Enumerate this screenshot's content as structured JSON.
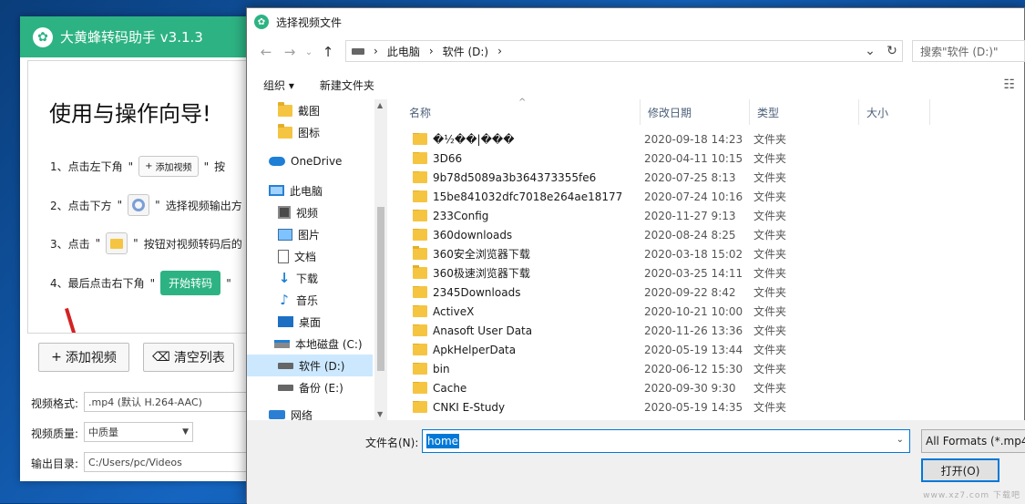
{
  "app": {
    "title": "大黄蜂转码助手 v3.1.3",
    "logo_text": "✿",
    "guide_title": "使用与操作向导!",
    "step1_prefix": "1、点击左下角",
    "step1_chip": "添加视频",
    "step1_suffix": "按",
    "step2_prefix": "2、点击下方",
    "step2_suffix": "选择视频输出方",
    "step3_prefix": "3、点击",
    "step3_suffix": "按钮对视频转码后的",
    "step4_prefix": "4、最后点击右下角",
    "step4_chip": "开始转码",
    "quote": "\"",
    "add_video_label": "添加视频",
    "clear_list_label": "清空列表",
    "format_label": "视频格式:",
    "format_value": ".mp4 (默认 H.264-AAC)",
    "quality_label": "视频质量:",
    "quality_value": "中质量",
    "output_label": "输出目录:",
    "output_value": "C:/Users/pc/Videos"
  },
  "dialog": {
    "title": "选择视频文件",
    "breadcrumb": [
      "此电脑",
      "软件 (D:)"
    ],
    "search_placeholder": "搜索\"软件 (D:)\"",
    "toolbar_organize": "组织 ▾",
    "toolbar_new_folder": "新建文件夹",
    "columns": [
      "名称",
      "修改日期",
      "类型",
      "大小"
    ],
    "tree": [
      {
        "label": "截图",
        "icon": "folder"
      },
      {
        "label": "图标",
        "icon": "folder"
      },
      {
        "label": "OneDrive",
        "icon": "cloud"
      },
      {
        "label": "此电脑",
        "icon": "pc"
      },
      {
        "label": "视频",
        "icon": "video"
      },
      {
        "label": "图片",
        "icon": "pic"
      },
      {
        "label": "文档",
        "icon": "doc"
      },
      {
        "label": "下载",
        "icon": "down"
      },
      {
        "label": "音乐",
        "icon": "music"
      },
      {
        "label": "桌面",
        "icon": "desk"
      },
      {
        "label": "本地磁盘 (C:)",
        "icon": "drive-c"
      },
      {
        "label": "软件 (D:)",
        "icon": "drive"
      },
      {
        "label": "备份 (E:)",
        "icon": "drive"
      },
      {
        "label": "网络",
        "icon": "net"
      }
    ],
    "files": [
      {
        "name": "�½��|���",
        "date": "2020-09-18 14:23",
        "type": "文件夹"
      },
      {
        "name": "3D66",
        "date": "2020-04-11 10:15",
        "type": "文件夹"
      },
      {
        "name": "9b78d5089a3b364373355fe6",
        "date": "2020-07-25 8:13",
        "type": "文件夹"
      },
      {
        "name": "15be841032dfc7018e264ae18177",
        "date": "2020-07-24 10:16",
        "type": "文件夹"
      },
      {
        "name": "233Config",
        "date": "2020-11-27 9:13",
        "type": "文件夹"
      },
      {
        "name": "360downloads",
        "date": "2020-08-24 8:25",
        "type": "文件夹"
      },
      {
        "name": "360安全浏览器下载",
        "date": "2020-03-18 15:02",
        "type": "文件夹"
      },
      {
        "name": "360极速浏览器下载",
        "date": "2020-03-25 14:11",
        "type": "文件夹"
      },
      {
        "name": "2345Downloads",
        "date": "2020-09-22 8:42",
        "type": "文件夹"
      },
      {
        "name": "ActiveX",
        "date": "2020-10-21 10:00",
        "type": "文件夹"
      },
      {
        "name": "Anasoft User Data",
        "date": "2020-11-26 13:36",
        "type": "文件夹"
      },
      {
        "name": "ApkHelperData",
        "date": "2020-05-19 13:44",
        "type": "文件夹"
      },
      {
        "name": "bin",
        "date": "2020-06-12 15:30",
        "type": "文件夹"
      },
      {
        "name": "Cache",
        "date": "2020-09-30 9:30",
        "type": "文件夹"
      },
      {
        "name": "CNKI E-Study",
        "date": "2020-05-19 14:35",
        "type": "文件夹"
      }
    ],
    "filename_label": "文件名(N):",
    "filename_value": "home",
    "format_filter": "All Formats (*.mp4",
    "open_button": "打开(O)"
  },
  "watermark": "www.xz7.com 下载吧",
  "colors": {
    "brand_green": "#2db383",
    "selection_blue": "#0078d7",
    "tree_selected": "#cce8ff",
    "folder_yellow": "#f5c542",
    "arrow_red": "#d42121"
  }
}
